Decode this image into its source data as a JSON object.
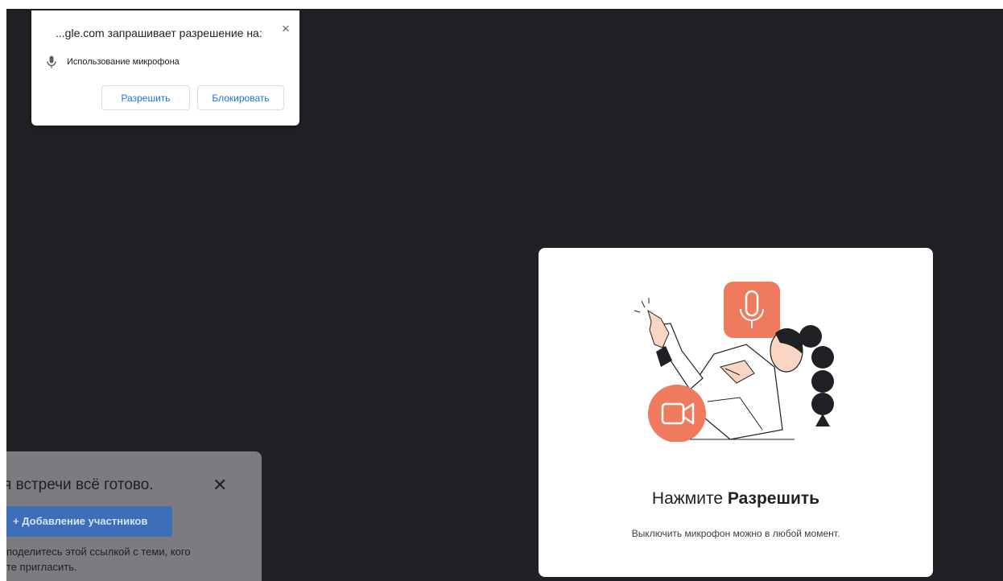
{
  "permission_popup": {
    "title": "...gle.com запрашивает разрешение на:",
    "close_glyph": "×",
    "item_icon": "mic-icon",
    "item_label": "Использование микрофона",
    "allow_label": "Разрешить",
    "block_label": "Блокировать",
    "accent_color": "#1a73e8"
  },
  "ready_panel": {
    "title": "я встречи всё готово.",
    "close_glyph": "✕",
    "add_button_label": "+ Добавление участников",
    "description_line1": "поделитесь этой ссылкой с теми, кого",
    "description_line2": "те пригласить."
  },
  "permission_card": {
    "title_prefix": "Нажмите ",
    "title_bold": "Разрешить",
    "subtitle": "Выключить микрофон можно в любой момент.",
    "illustration_icons": [
      "pointing-person-illustration",
      "mic-icon",
      "camera-icon"
    ],
    "illustration_accent": "#f07a5e"
  },
  "colors": {
    "stage_background": "#202124",
    "card_background": "#ffffff",
    "panel_background": "#7b7c7f",
    "add_button": "#3c6fb8"
  }
}
